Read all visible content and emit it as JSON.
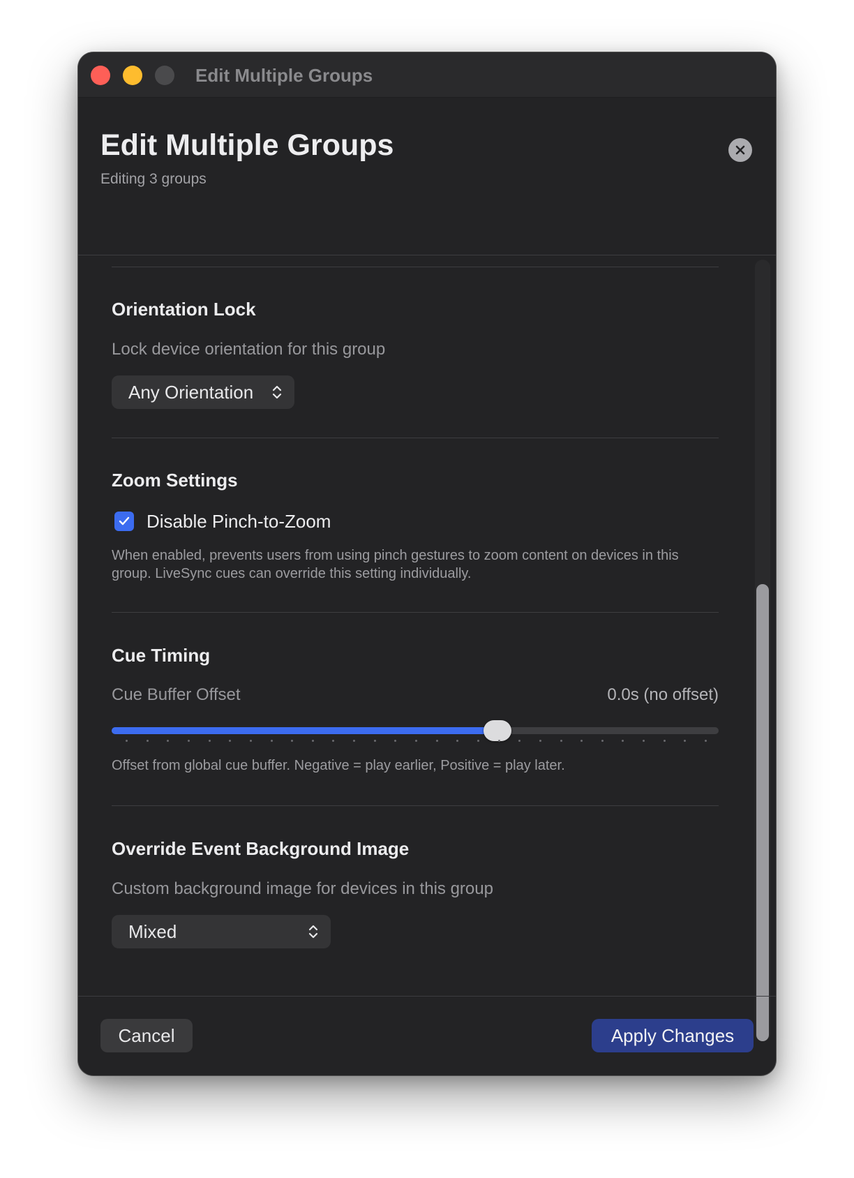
{
  "window": {
    "title": "Edit Multiple Groups"
  },
  "header": {
    "title": "Edit Multiple Groups",
    "subtitle": "Editing 3 groups",
    "close_icon": "close-icon"
  },
  "sections": {
    "orientation": {
      "title": "Orientation Lock",
      "description": "Lock device orientation for this group",
      "selected": "Any Orientation"
    },
    "zoom": {
      "title": "Zoom Settings",
      "checkbox_label": "Disable Pinch-to-Zoom",
      "checked": true,
      "help": "When enabled, prevents users from using pinch gestures to zoom content on devices in this group. LiveSync cues can override this setting individually."
    },
    "cue_timing": {
      "title": "Cue Timing",
      "slider_label": "Cue Buffer Offset",
      "slider_value_text": "0.0s (no offset)",
      "slider_fraction": 0.636,
      "help": "Offset from global cue buffer. Negative = play earlier, Positive = play later."
    },
    "background": {
      "title": "Override Event Background Image",
      "description": "Custom background image for devices in this group",
      "selected": "Mixed"
    }
  },
  "footer": {
    "cancel_label": "Cancel",
    "apply_label": "Apply Changes"
  },
  "colors": {
    "accent": "#3c6cf0",
    "apply_button": "#2c3e8c",
    "traffic_close": "#fe5f57",
    "traffic_minimize": "#febc2e",
    "traffic_zoom": "#4a4a4c"
  }
}
